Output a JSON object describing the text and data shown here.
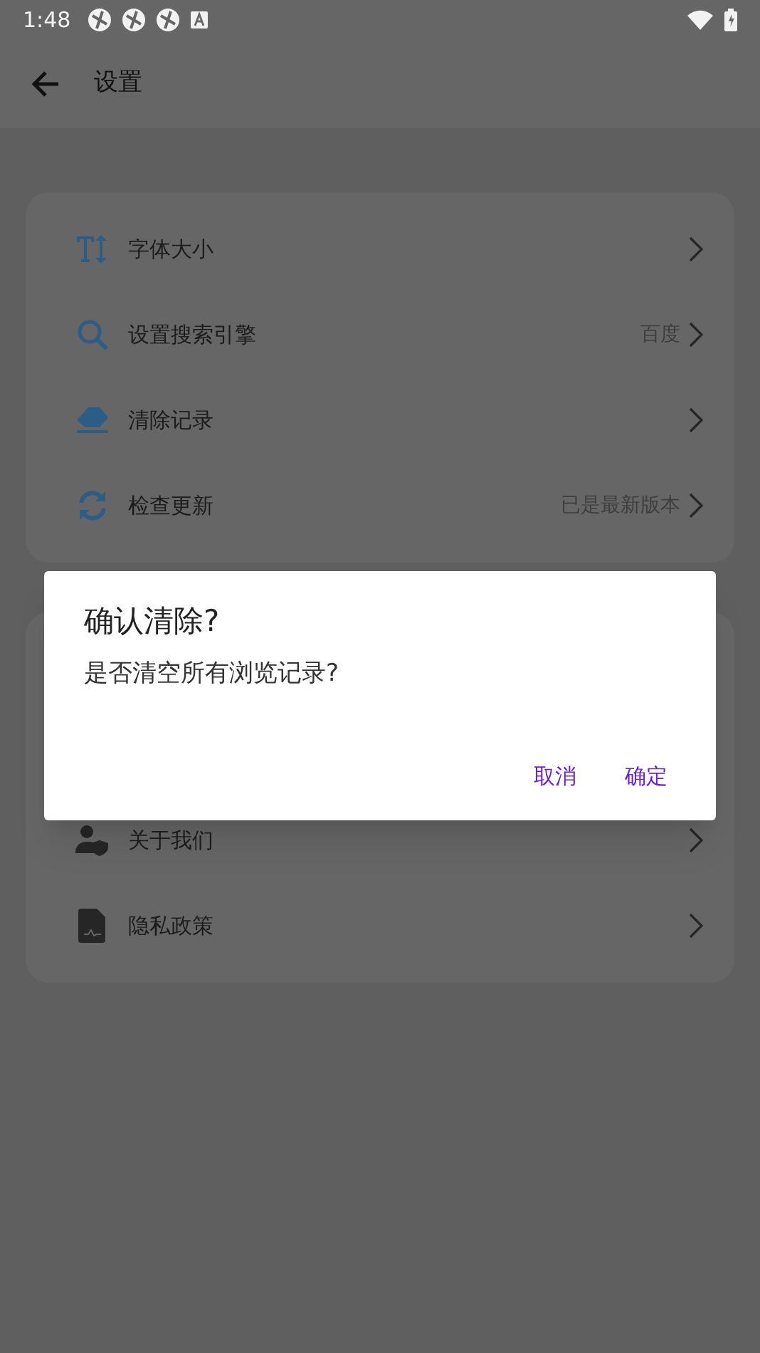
{
  "status_bar": {
    "time": "1:48"
  },
  "header": {
    "title": "设置"
  },
  "groups": [
    {
      "items": [
        {
          "kind": "font-size",
          "label": "字体大小"
        },
        {
          "kind": "search",
          "label": "设置搜索引擎",
          "value": "百度"
        },
        {
          "kind": "eraser",
          "label": "清除记录"
        },
        {
          "kind": "refresh",
          "label": "检查更新",
          "value": "已是最新版本"
        }
      ]
    },
    {
      "items": [
        {
          "kind": "about",
          "label": "关于我们"
        },
        {
          "kind": "document",
          "label": "隐私政策"
        }
      ]
    }
  ],
  "dialog": {
    "title": "确认清除?",
    "message": "是否清空所有浏览记录?",
    "buttons": [
      "取消",
      "确定"
    ]
  }
}
